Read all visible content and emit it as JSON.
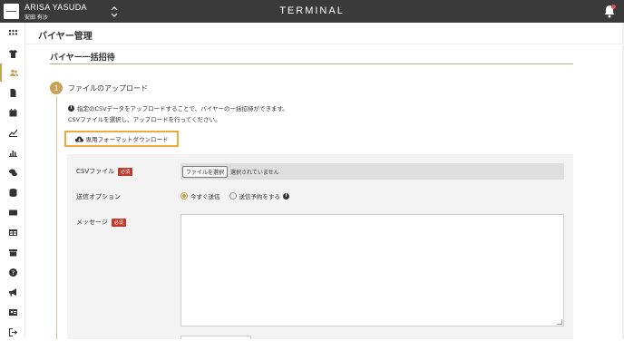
{
  "topbar": {
    "user_name": "ARISA YASUDA",
    "user_sub": "安田 有沙",
    "brand": "TERMINAL"
  },
  "sidebar": {
    "items": [
      {
        "icon": "grid-icon"
      },
      {
        "icon": "tshirt-icon"
      },
      {
        "icon": "users-icon",
        "active": true
      },
      {
        "icon": "document-icon"
      },
      {
        "icon": "calendar-icon"
      },
      {
        "icon": "chart-line-icon"
      },
      {
        "icon": "chart-bar-icon"
      },
      {
        "icon": "chat-icon"
      },
      {
        "icon": "database-icon"
      },
      {
        "icon": "mail-icon"
      },
      {
        "icon": "table-icon"
      },
      {
        "icon": "archive-icon"
      },
      {
        "icon": "help-icon"
      },
      {
        "icon": "megaphone-icon"
      },
      {
        "icon": "id-card-icon"
      },
      {
        "icon": "logout-icon"
      }
    ]
  },
  "page": {
    "title": "バイヤー管理",
    "section_title": "バイヤー一括招待"
  },
  "step": {
    "number": "1",
    "title": "ファイルのアップロード",
    "info_line1": "指定のCSVデータをアップロードすることで、バイヤーの一括招待ができます。",
    "info_line2": "CSVファイルを選択し、アップロードを行ってください。",
    "download_label": "専用フォーマットダウンロード"
  },
  "form": {
    "csv_label": "CSVファイル",
    "required_badge": "必須",
    "file_button": "ファイルを選択",
    "file_status": "選択されていません",
    "option_label": "送信オプション",
    "option_now": "今すぐ送信",
    "option_scheduled": "送信予約をする",
    "message_label": "メッセージ",
    "message_value": ""
  },
  "colors": {
    "accent": "#c7a157",
    "topbar": "#3a3a3a",
    "highlight_border": "#f0a93a",
    "required_badge": "#c0392b"
  }
}
